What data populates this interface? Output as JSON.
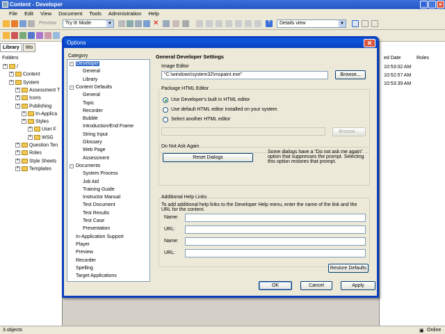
{
  "app": {
    "title": "Content - Developer"
  },
  "menu": [
    "File",
    "Edit",
    "View",
    "Document",
    "Tools",
    "Administration",
    "Help"
  ],
  "toolbar": {
    "preview_label": "Preview",
    "mode_select": "Try It! Mode",
    "view_select": "Details view"
  },
  "library": {
    "tabs": [
      "Library",
      "Wo"
    ],
    "folders_header": "Folders",
    "tree": [
      {
        "label": "/",
        "depth": 0
      },
      {
        "label": "Content",
        "depth": 1
      },
      {
        "label": "System",
        "depth": 1
      },
      {
        "label": "Assessment T",
        "depth": 2
      },
      {
        "label": "Icons",
        "depth": 2
      },
      {
        "label": "Publishing",
        "depth": 2
      },
      {
        "label": "In-Applica",
        "depth": 3
      },
      {
        "label": "Styles",
        "depth": 3
      },
      {
        "label": "User F",
        "depth": 4
      },
      {
        "label": "WSG",
        "depth": 4
      },
      {
        "label": "Question Ten",
        "depth": 2
      },
      {
        "label": "Roles",
        "depth": 2
      },
      {
        "label": "Style Sheets",
        "depth": 2
      },
      {
        "label": "Templates",
        "depth": 2
      }
    ]
  },
  "details": {
    "columns": [
      "ed Date",
      "Roles"
    ],
    "rows": [
      "10:53:02 AM",
      "10:52:57 AM",
      "10:53:39 AM"
    ]
  },
  "status": {
    "left": "3 objects",
    "right": "Online"
  },
  "dialog": {
    "title": "Options",
    "category_label": "Category",
    "categories": [
      {
        "label": "Developer",
        "depth": 0,
        "selected": true
      },
      {
        "label": "General",
        "depth": 1
      },
      {
        "label": "Library",
        "depth": 1
      },
      {
        "label": "Content Defaults",
        "depth": 0
      },
      {
        "label": "General",
        "depth": 1
      },
      {
        "label": "Topic",
        "depth": 1
      },
      {
        "label": "Recorder",
        "depth": 1
      },
      {
        "label": "Bubble",
        "depth": 1
      },
      {
        "label": "Introduction/End Frame",
        "depth": 1
      },
      {
        "label": "String Input",
        "depth": 1
      },
      {
        "label": "Glossary",
        "depth": 1
      },
      {
        "label": "Web Page",
        "depth": 1
      },
      {
        "label": "Assessment",
        "depth": 1
      },
      {
        "label": "Documents",
        "depth": 0
      },
      {
        "label": "System Process",
        "depth": 1
      },
      {
        "label": "Job Aid",
        "depth": 1
      },
      {
        "label": "Training Guide",
        "depth": 1
      },
      {
        "label": "Instructor Manual",
        "depth": 1
      },
      {
        "label": "Test Document",
        "depth": 1
      },
      {
        "label": "Test Results",
        "depth": 1
      },
      {
        "label": "Test Case",
        "depth": 1
      },
      {
        "label": "Presentation",
        "depth": 1
      },
      {
        "label": "In-Application Support",
        "depth": 0
      },
      {
        "label": "Player",
        "depth": 0
      },
      {
        "label": "Preview",
        "depth": 0
      },
      {
        "label": "Recorder",
        "depth": 0
      },
      {
        "label": "Spelling",
        "depth": 0
      },
      {
        "label": "Target Applications",
        "depth": 0
      }
    ],
    "heading": "General Developer Settings",
    "image_editor": {
      "label": "Image Editor",
      "path": "\"C:\\windows\\system32\\mspaint.exe\"",
      "browse": "Browse..."
    },
    "html_editor": {
      "label": "Package HTML Editor",
      "options": [
        "Use Developer's built in HTML editor",
        "Use default HTML editor installed on your system",
        "Select another HTML editor"
      ],
      "selected_index": 0,
      "path": "",
      "browse": "Browse..."
    },
    "do_not_ask": {
      "label": "Do Not Ask Again",
      "button": "Reset Dialogs",
      "text": "Some dialogs have a \"Do not ask me again\" option that suppresses the prompt. Selecting this option restores that prompt."
    },
    "help_links": {
      "label": "Additional Help Links",
      "text": "To add additional help links to the Developer Help menu, enter the name of the link and the URL for the content.",
      "fields": [
        "Name:",
        "URL:",
        "Name:",
        "URL:"
      ]
    },
    "restore_defaults": "Restore Defaults",
    "ok": "OK",
    "cancel": "Cancel",
    "apply": "Apply"
  }
}
